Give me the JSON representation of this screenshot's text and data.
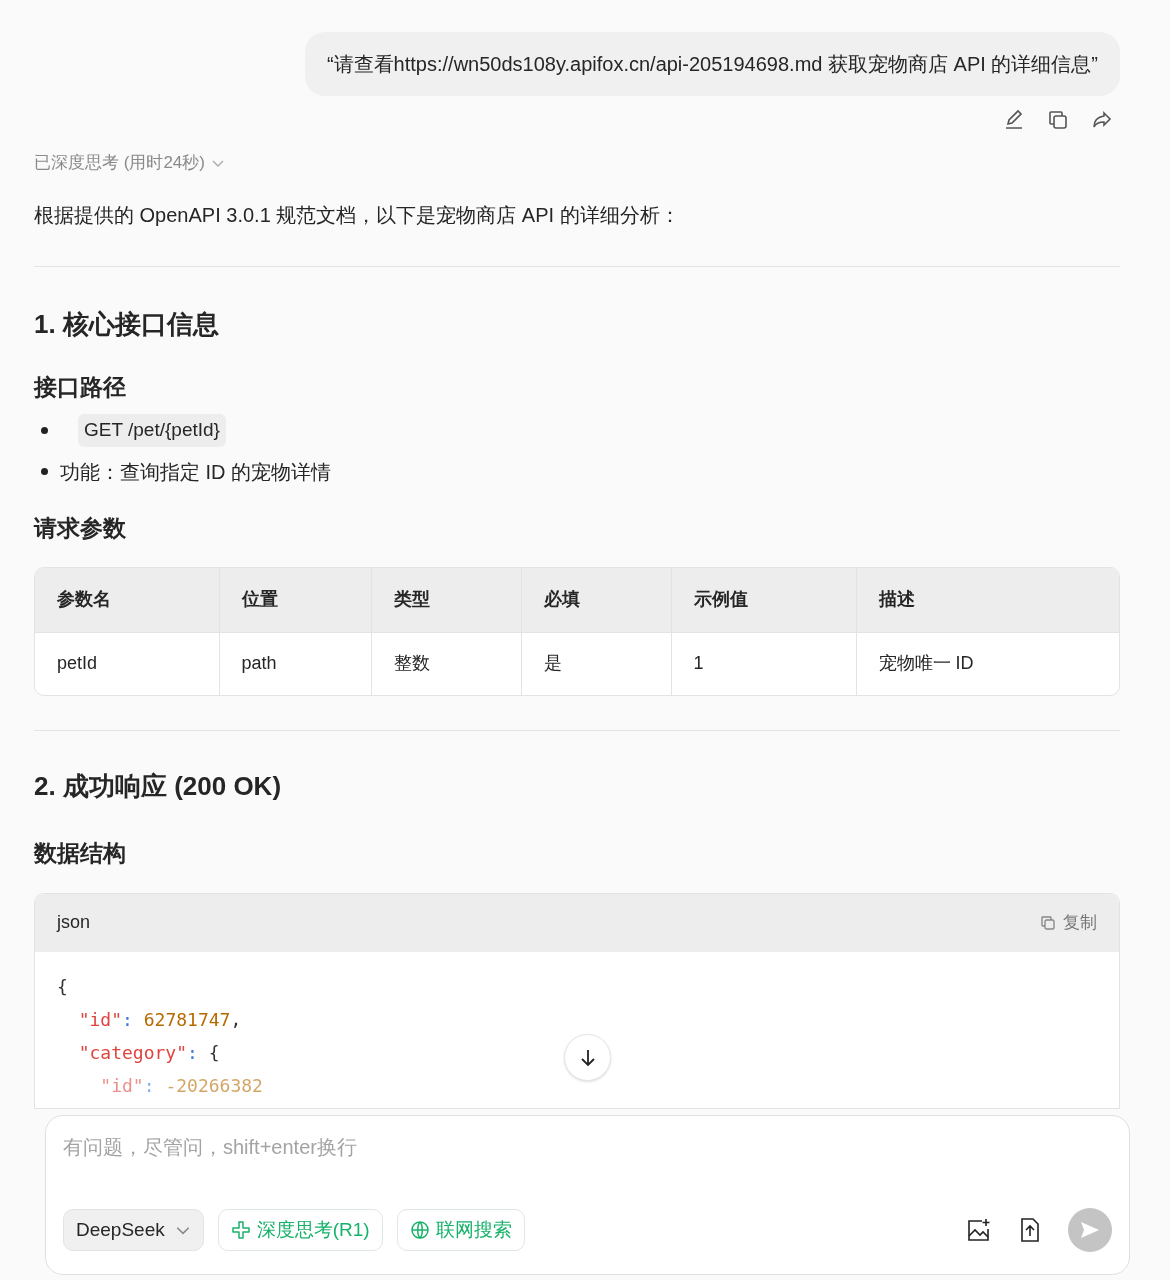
{
  "user_message": {
    "text": "“请查看https://wn50ds108y.apifox.cn/api-205194698.md 获取宠物商店 API 的详细信息”"
  },
  "thinking": {
    "label": "已深度思考 (用时24秒)",
    "expanded": false
  },
  "answer": {
    "intro": "根据提供的 OpenAPI 3.0.1 规范文档，以下是宠物商店 API 的详细分析：",
    "section1": {
      "heading": "1. 核心接口信息",
      "subheading": "接口路径",
      "bullets": [
        {
          "kind": "code",
          "text": "GET /pet/{petId}"
        },
        {
          "kind": "text",
          "text": "功能：查询指定 ID 的宠物详情"
        }
      ],
      "params_heading": "请求参数",
      "table": {
        "columns": [
          "参数名",
          "位置",
          "类型",
          "必填",
          "示例值",
          "描述"
        ],
        "rows": [
          [
            "petId",
            "path",
            "整数",
            "是",
            "1",
            "宠物唯一 ID"
          ]
        ]
      }
    },
    "section2": {
      "heading": "2. 成功响应 (200 OK)",
      "subheading": "数据结构",
      "code_block": {
        "language": "json",
        "copy_label": "复制",
        "lines": [
          [
            {
              "kind": "punct",
              "s": "{"
            }
          ],
          [
            {
              "kind": "key",
              "s": "  \"id\""
            },
            {
              "kind": "colon",
              "s": ": "
            },
            {
              "kind": "num",
              "s": "62781747"
            },
            {
              "kind": "punct",
              "s": ","
            }
          ],
          [
            {
              "kind": "key",
              "s": "  \"category\""
            },
            {
              "kind": "colon",
              "s": ": "
            },
            {
              "kind": "punct",
              "s": "{"
            }
          ],
          [
            {
              "kind": "key",
              "s": "    \"id\""
            },
            {
              "kind": "colon",
              "s": ": "
            },
            {
              "kind": "num",
              "s": "-20266382"
            }
          ]
        ]
      }
    }
  },
  "composer": {
    "placeholder": "有问题，尽管问，shift+enter换行",
    "model": "DeepSeek",
    "toggles": [
      {
        "kind": "think",
        "label": "深度思考(R1)",
        "selected": true
      },
      {
        "kind": "web",
        "label": "联网搜索",
        "selected": true
      }
    ],
    "send_enabled": false
  }
}
